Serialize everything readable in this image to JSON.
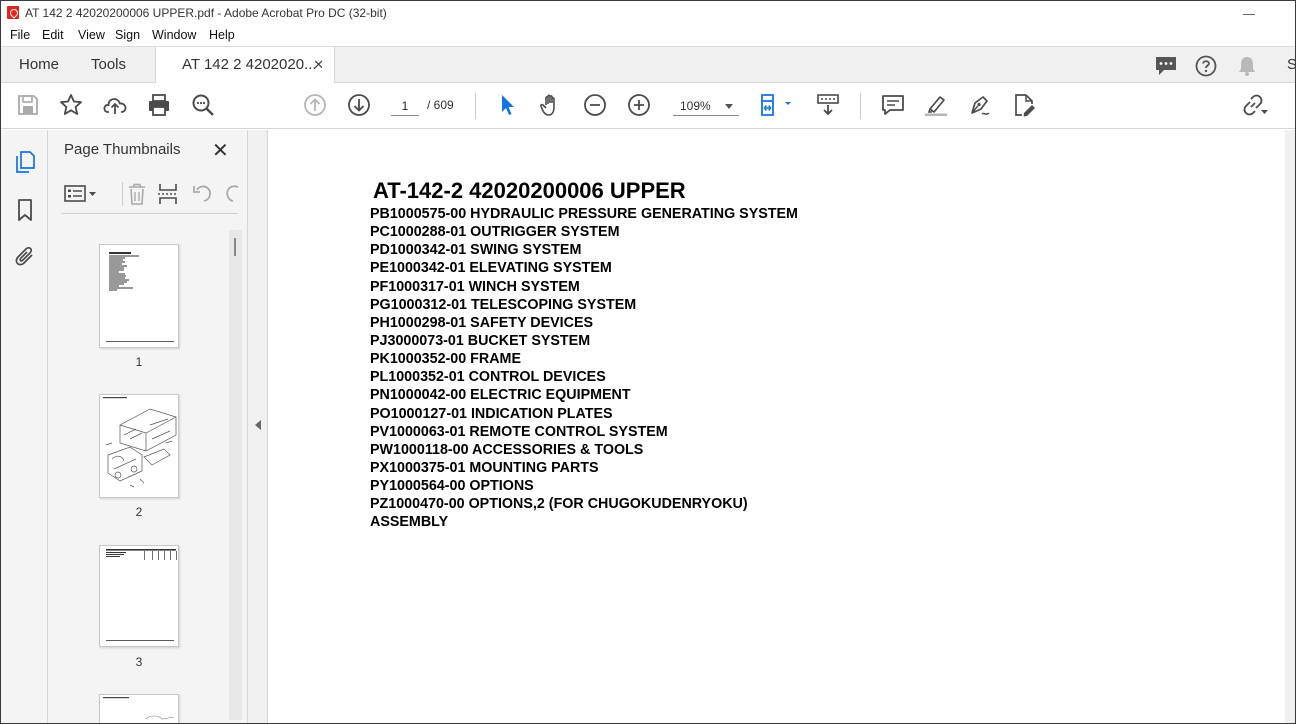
{
  "window": {
    "title": "AT 142 2 42020200006 UPPER.pdf - Adobe Acrobat Pro DC (32-bit)",
    "menu": [
      "File",
      "Edit",
      "View",
      "Sign",
      "Window",
      "Help"
    ]
  },
  "tabs": {
    "home": "Home",
    "tools": "Tools",
    "document": "AT 142 2 4202020...",
    "overflow_letter": "S"
  },
  "toolbar": {
    "current_page": "1",
    "page_total": "/ 609",
    "zoom": "109%"
  },
  "panel": {
    "title": "Page Thumbnails",
    "thumbnails": [
      {
        "label": "1"
      },
      {
        "label": "2"
      },
      {
        "label": "3"
      }
    ]
  },
  "document": {
    "title": "AT-142-2 42020200006 UPPER",
    "lines": [
      "PB1000575-00 HYDRAULIC PRESSURE GENERATING SYSTEM",
      "PC1000288-01 OUTRIGGER SYSTEM",
      "PD1000342-01 SWING SYSTEM",
      "PE1000342-01 ELEVATING SYSTEM",
      "PF1000317-01 WINCH SYSTEM",
      "PG1000312-01 TELESCOPING SYSTEM",
      "PH1000298-01 SAFETY DEVICES",
      "PJ3000073-01 BUCKET SYSTEM",
      "PK1000352-00 FRAME",
      "PL1000352-01 CONTROL DEVICES",
      "PN1000042-00 ELECTRIC EQUIPMENT",
      "PO1000127-01 INDICATION PLATES",
      "PV1000063-01 REMOTE CONTROL SYSTEM",
      "PW1000118-00 ACCESSORIES & TOOLS",
      "PX1000375-01 MOUNTING PARTS",
      "PY1000564-00 OPTIONS",
      "PZ1000470-00 OPTIONS,2 (FOR CHUGOKUDENRYOKU)",
      "ASSEMBLY"
    ]
  },
  "colors": {
    "acrobat_red": "#e0251b",
    "select_blue": "#1473e6",
    "icon_gray": "#4b4b4b"
  }
}
